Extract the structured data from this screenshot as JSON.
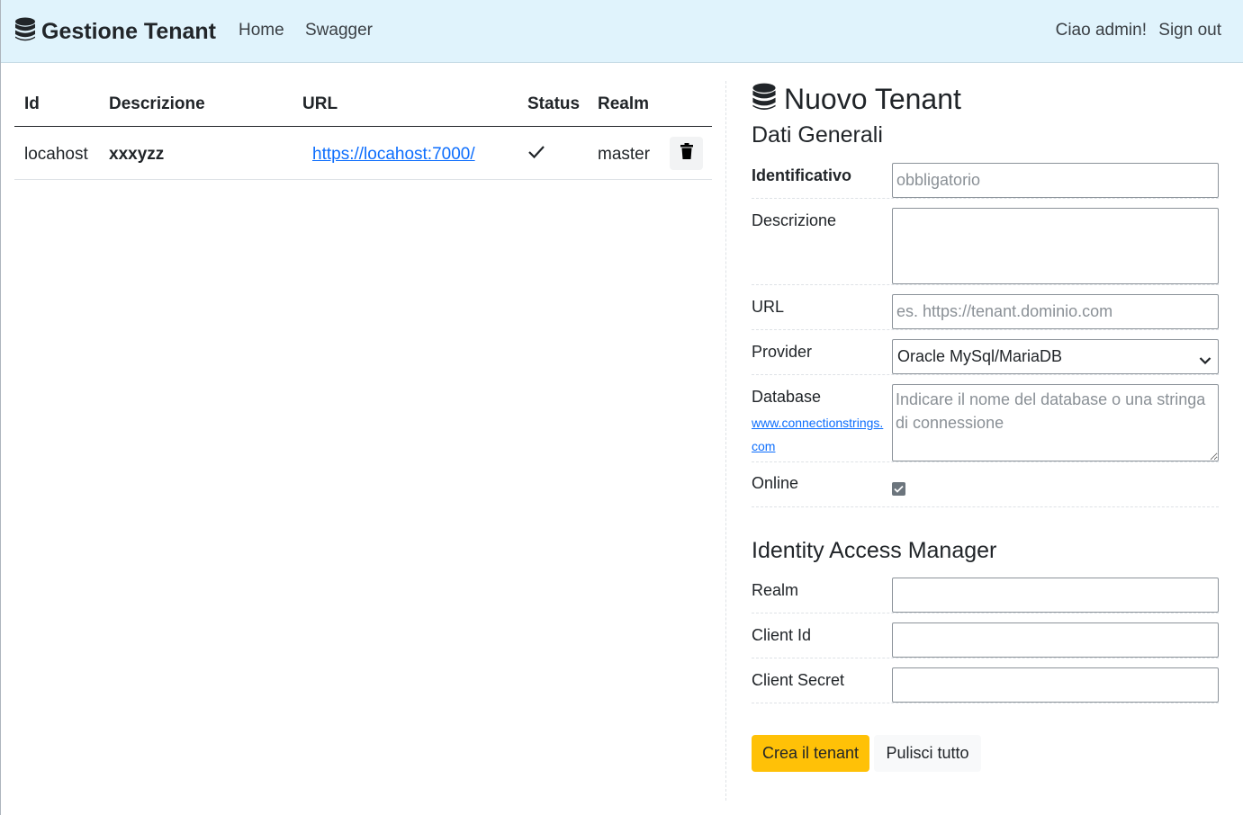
{
  "navbar": {
    "brand": "Gestione Tenant",
    "links": [
      "Home",
      "Swagger"
    ],
    "greeting": "Ciao admin!",
    "signout": "Sign out"
  },
  "table": {
    "headers": [
      "Id",
      "Descrizione",
      "URL",
      "Status",
      "Realm"
    ],
    "rows": [
      {
        "id": "locahost",
        "descrizione": "xxxyzz",
        "url": "https://locahost:7000/",
        "status": "check-icon",
        "realm": "master"
      }
    ]
  },
  "form": {
    "title": "Nuovo Tenant",
    "section_general": "Dati Generali",
    "identificativo": {
      "label": "Identificativo",
      "placeholder": "obbligatorio",
      "value": ""
    },
    "descrizione": {
      "label": "Descrizione",
      "value": ""
    },
    "url": {
      "label": "URL",
      "placeholder": "es. https://tenant.dominio.com",
      "value": ""
    },
    "provider": {
      "label": "Provider",
      "selected": "Oracle MySql/MariaDB"
    },
    "database": {
      "label": "Database",
      "link": "www.connectionstrings.com",
      "placeholder": "Indicare il nome del database o una stringa di connessione",
      "value": ""
    },
    "online": {
      "label": "Online",
      "checked": true
    },
    "section_iam": "Identity Access Manager",
    "realm": {
      "label": "Realm",
      "value": ""
    },
    "client_id": {
      "label": "Client Id",
      "value": ""
    },
    "client_secret": {
      "label": "Client Secret",
      "value": ""
    },
    "create_button": "Crea il tenant",
    "clear_button": "Pulisci tutto"
  },
  "colors": {
    "navbar_bg": "#e0f3fc",
    "primary_button": "#ffc107",
    "link": "#0d6efd"
  }
}
